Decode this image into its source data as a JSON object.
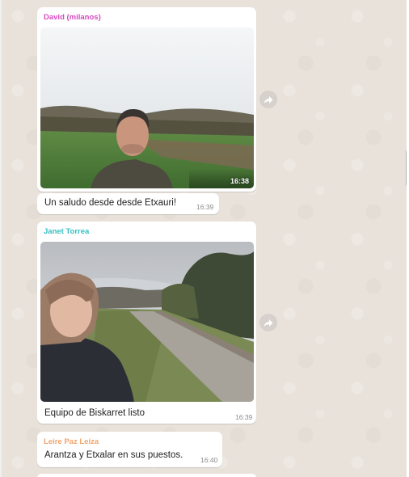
{
  "messages": [
    {
      "sender": "David (milanos)",
      "sender_color": "#d44bbf",
      "photo_time": "16:38",
      "caption": "Un saludo desde desde Etxauri!",
      "caption_time": "16:39"
    },
    {
      "sender": "Janet Torrea",
      "sender_color": "#35c0c4",
      "caption": "Equipo de Biskarret listo",
      "caption_time": "16:39"
    },
    {
      "sender": "Leire Paz Leiza",
      "sender_color": "#f0a36b",
      "caption": "Arantza y Etxalar en sus puestos.",
      "caption_time": "16:40"
    }
  ],
  "icons": {
    "forward": "forward-arrow-icon"
  }
}
